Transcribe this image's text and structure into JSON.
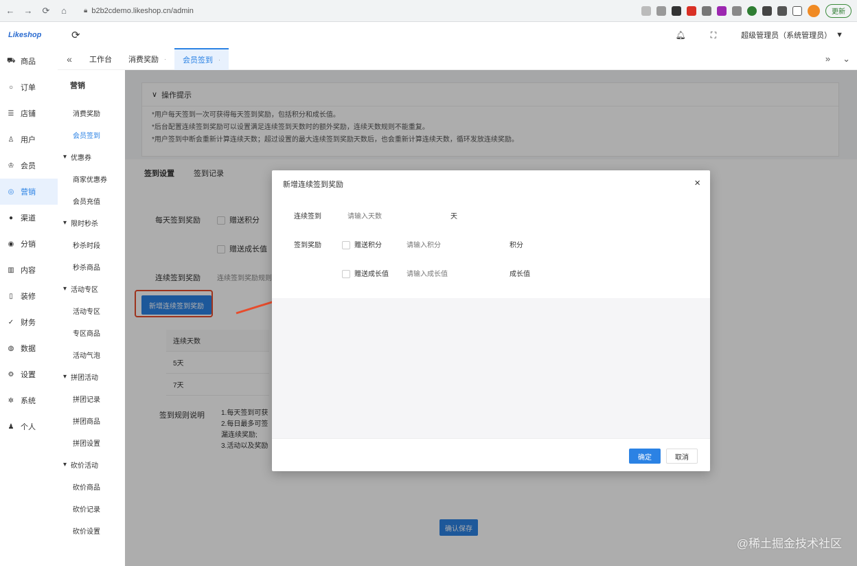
{
  "browser": {
    "url": "b2b2cdemo.likeshop.cn/admin",
    "update_label": "更新"
  },
  "header": {
    "logo": "Likeshop",
    "user_label": "超级管理员（系统管理员）"
  },
  "main_nav": {
    "items": [
      {
        "label": "商品",
        "icon": "cart-icon"
      },
      {
        "label": "订单",
        "icon": "order-icon"
      },
      {
        "label": "店铺",
        "icon": "store-icon"
      },
      {
        "label": "用户",
        "icon": "user-icon"
      },
      {
        "label": "会员",
        "icon": "member-icon"
      },
      {
        "label": "营销",
        "icon": "marketing-icon"
      },
      {
        "label": "渠道",
        "icon": "channel-icon"
      },
      {
        "label": "分销",
        "icon": "distribution-icon"
      },
      {
        "label": "内容",
        "icon": "content-icon"
      },
      {
        "label": "装修",
        "icon": "decoration-icon"
      },
      {
        "label": "财务",
        "icon": "finance-icon"
      },
      {
        "label": "数据",
        "icon": "data-icon"
      },
      {
        "label": "设置",
        "icon": "settings-icon"
      },
      {
        "label": "系统",
        "icon": "system-icon"
      },
      {
        "label": "个人",
        "icon": "person-icon"
      }
    ]
  },
  "tabs": {
    "items": [
      "工作台",
      "消费奖励",
      "会员签到"
    ]
  },
  "sub_nav": {
    "title": "营销",
    "items": [
      {
        "label": "消费奖励",
        "type": "item"
      },
      {
        "label": "会员签到",
        "type": "item"
      },
      {
        "label": "优惠券",
        "type": "group"
      },
      {
        "label": "商家优惠券",
        "type": "item"
      },
      {
        "label": "会员充值",
        "type": "item"
      },
      {
        "label": "限时秒杀",
        "type": "group"
      },
      {
        "label": "秒杀时段",
        "type": "item"
      },
      {
        "label": "秒杀商品",
        "type": "item"
      },
      {
        "label": "活动专区",
        "type": "group"
      },
      {
        "label": "活动专区",
        "type": "item"
      },
      {
        "label": "专区商品",
        "type": "item"
      },
      {
        "label": "活动气泡",
        "type": "item"
      },
      {
        "label": "拼团活动",
        "type": "group"
      },
      {
        "label": "拼团记录",
        "type": "item"
      },
      {
        "label": "拼团商品",
        "type": "item"
      },
      {
        "label": "拼团设置",
        "type": "item"
      },
      {
        "label": "砍价活动",
        "type": "group"
      },
      {
        "label": "砍价商品",
        "type": "item"
      },
      {
        "label": "砍价记录",
        "type": "item"
      },
      {
        "label": "砍价设置",
        "type": "item"
      }
    ]
  },
  "tips": {
    "title": "操作提示",
    "lines": [
      "*用户每天签到一次可获得每天签到奖励，包括积分和成长值。",
      "*后台配置连续签到奖励可以设置满足连续签到天数时的额外奖励，连续天数规则不能重复。",
      "*用户签到中断会重新计算连续天数；超过设置的最大连续签到奖励天数后，也会重新计算连续天数，循环发放连续奖励。"
    ]
  },
  "page": {
    "sub_tabs": [
      "签到设置",
      "签到记录"
    ],
    "daily_reward_label": "每天签到奖励",
    "give_points_label": "赠送积分",
    "give_growth_label": "赠送成长值",
    "continuous_reward_label": "连续签到奖励",
    "continuous_reward_hint": "连续签到奖励规则",
    "add_button": "新增连续签到奖励",
    "table_head": "连续天数",
    "table_rows": [
      "5天",
      "7天"
    ],
    "rules_label": "签到规则说明",
    "rules_lines": [
      "1.每天签到可获",
      "2.每日最多可签",
      "漏连续奖励;",
      "3.活动以及奖励"
    ],
    "save_button": "确认保存"
  },
  "modal": {
    "title": "新增连续签到奖励",
    "days_label": "连续签到",
    "days_placeholder": "请输入天数",
    "days_unit": "天",
    "reward_label": "签到奖励",
    "points_check": "赠送积分",
    "points_placeholder": "请输入积分",
    "points_unit": "积分",
    "growth_check": "赠送成长值",
    "growth_placeholder": "请输入成长值",
    "growth_unit": "成长值",
    "ok": "确定",
    "cancel": "取消"
  },
  "watermark": "@稀土掘金技术社区",
  "colors": {
    "accent": "#2b82e4",
    "highlight": "#e74c2c"
  }
}
